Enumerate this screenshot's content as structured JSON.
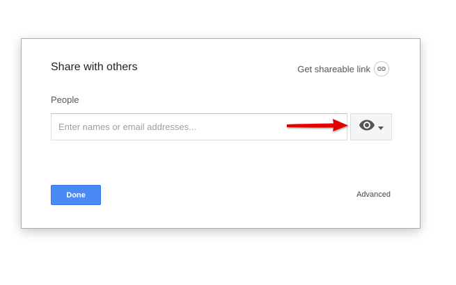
{
  "dialog": {
    "title": "Share with others",
    "shareable_link_label": "Get shareable link",
    "people_label": "People",
    "people_input": {
      "placeholder": "Enter names or email addresses...",
      "value": ""
    },
    "permission_button_icon": "eye-icon",
    "done_label": "Done",
    "advanced_label": "Advanced"
  },
  "annotation": {
    "arrow_icon": "red-arrow-icon",
    "arrow_color": "#e00000"
  },
  "colors": {
    "primary_button": "#4a8af4",
    "icon_gray": "#555555"
  }
}
